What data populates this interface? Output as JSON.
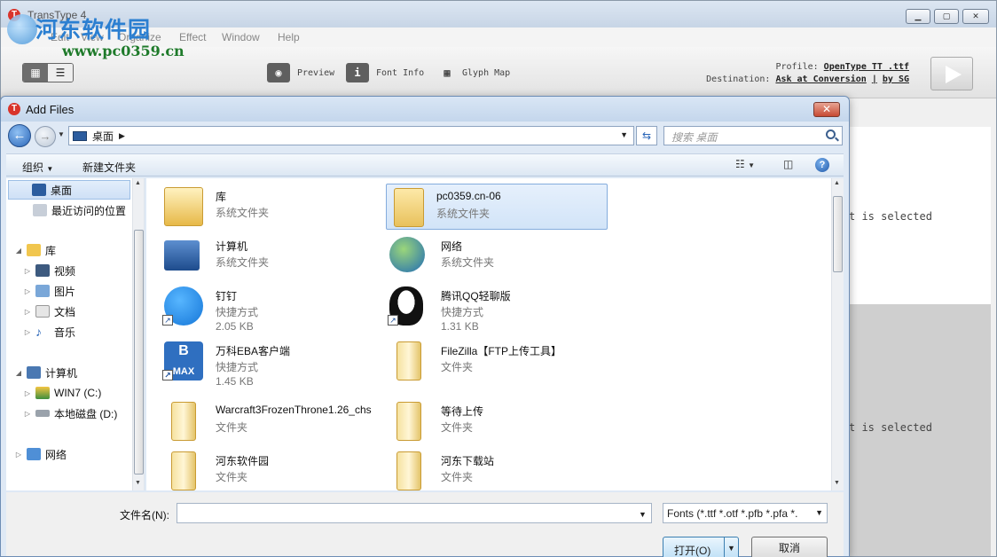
{
  "app": {
    "title": "TransType 4",
    "menus": [
      "Edit",
      "View",
      "Organize",
      "Effect",
      "Window",
      "Help"
    ],
    "toolbar": {
      "preview": "Preview",
      "font_info": "Font Info",
      "glyph_map": "Glyph Map",
      "profile_label": "Profile:",
      "profile_value": "OpenType TT .ttf",
      "destination_label": "Destination:",
      "destination_value": "Ask at Conversion",
      "destination_sep": "|",
      "destination_by": "by SG"
    },
    "panel_top_msg": "t is selected",
    "panel_bottom_msg": "t is selected"
  },
  "watermark": {
    "title": "河东软件园",
    "url": "www.pc0359.cn"
  },
  "dialog": {
    "title": "Add Files",
    "address_crumb": "桌面",
    "search_placeholder": "搜索 桌面",
    "cmd_organize": "组织",
    "cmd_new_folder": "新建文件夹",
    "tree": [
      {
        "label": "桌面",
        "selected": true,
        "indent": 0,
        "icon": "desktop-icon"
      },
      {
        "label": "最近访问的位置",
        "selected": false,
        "indent": 0,
        "icon": "recent-icon"
      },
      {
        "label": "库",
        "selected": false,
        "indent": 0,
        "icon": "library-icon"
      },
      {
        "label": "视频",
        "selected": false,
        "indent": 1,
        "icon": "video-icon"
      },
      {
        "label": "图片",
        "selected": false,
        "indent": 1,
        "icon": "picture-icon"
      },
      {
        "label": "文档",
        "selected": false,
        "indent": 1,
        "icon": "document-icon"
      },
      {
        "label": "音乐",
        "selected": false,
        "indent": 1,
        "icon": "music-icon"
      },
      {
        "label": "计算机",
        "selected": false,
        "indent": 0,
        "icon": "computer-icon"
      },
      {
        "label": "WIN7 (C:)",
        "selected": false,
        "indent": 1,
        "icon": "drive-c-icon"
      },
      {
        "label": "本地磁盘 (D:)",
        "selected": false,
        "indent": 1,
        "icon": "drive-d-icon"
      },
      {
        "label": "网络",
        "selected": false,
        "indent": 0,
        "icon": "network-icon"
      }
    ],
    "files": [
      {
        "name": "库",
        "type": "系统文件夹",
        "size": "",
        "icon": "library-folder-icon",
        "selected": false
      },
      {
        "name": "pc0359.cn-06",
        "type": "系统文件夹",
        "size": "",
        "icon": "user-folder-icon",
        "selected": true
      },
      {
        "name": "计算机",
        "type": "系统文件夹",
        "size": "",
        "icon": "computer-icon",
        "selected": false
      },
      {
        "name": "网络",
        "type": "系统文件夹",
        "size": "",
        "icon": "network-globe-icon",
        "selected": false
      },
      {
        "name": "钉钉",
        "type": "快捷方式",
        "size": "2.05 KB",
        "icon": "dingtalk-icon",
        "selected": false
      },
      {
        "name": "腾讯QQ轻聊版",
        "type": "快捷方式",
        "size": "1.31 KB",
        "icon": "qq-penguin-icon",
        "selected": false
      },
      {
        "name": "万科EBA客户端",
        "type": "快捷方式",
        "size": "1.45 KB",
        "icon": "bmax-app-icon",
        "selected": false
      },
      {
        "name": "FileZilla【FTP上传工具】",
        "type": "文件夹",
        "size": "",
        "icon": "folder-icon",
        "selected": false
      },
      {
        "name": "Warcraft3FrozenThrone1.26_chs",
        "type": "文件夹",
        "size": "",
        "icon": "folder-icon",
        "selected": false
      },
      {
        "name": "等待上传",
        "type": "文件夹",
        "size": "",
        "icon": "folder-icon",
        "selected": false
      },
      {
        "name": "河东软件园",
        "type": "文件夹",
        "size": "",
        "icon": "folder-icon",
        "selected": false
      },
      {
        "name": "河东下载站",
        "type": "文件夹",
        "size": "",
        "icon": "folder-icon",
        "selected": false
      }
    ],
    "filename_label": "文件名(N):",
    "filename_value": "",
    "filetype_value": "Fonts (*.ttf *.otf *.pfb *.pfa *.",
    "open_label": "打开(O)",
    "cancel_label": "取消"
  }
}
